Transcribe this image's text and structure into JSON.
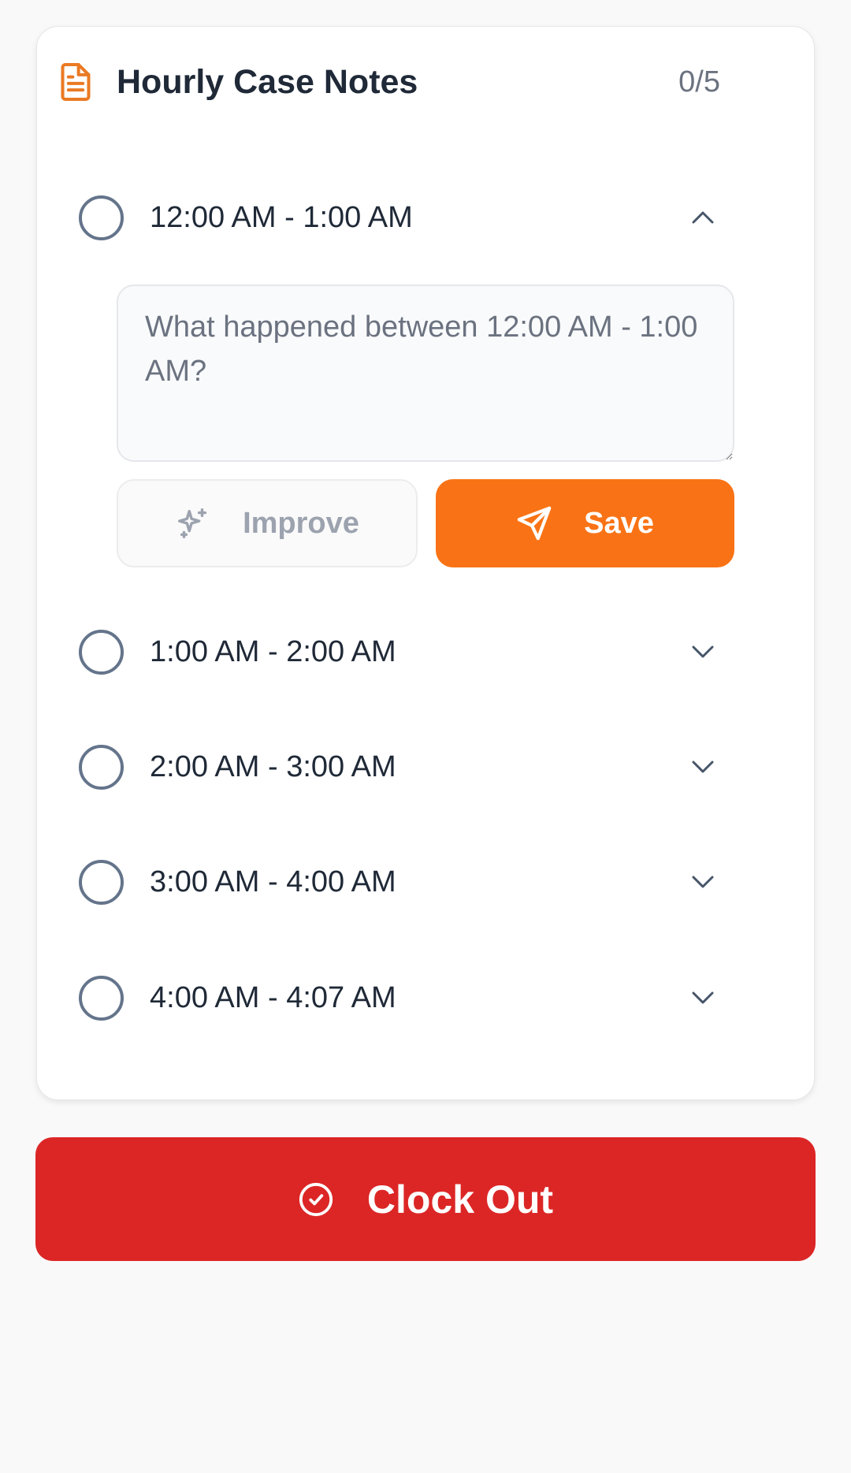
{
  "card": {
    "title": "Hourly Case Notes",
    "progress": "0/5",
    "title_icon": "document-icon"
  },
  "slots": [
    {
      "label": "12:00 AM - 1:00 AM",
      "expanded": true,
      "completed": false
    },
    {
      "label": "1:00 AM - 2:00 AM",
      "expanded": false,
      "completed": false
    },
    {
      "label": "2:00 AM - 3:00 AM",
      "expanded": false,
      "completed": false
    },
    {
      "label": "3:00 AM - 4:00 AM",
      "expanded": false,
      "completed": false
    },
    {
      "label": "4:00 AM - 4:07 AM",
      "expanded": false,
      "completed": false
    }
  ],
  "note": {
    "value": "",
    "placeholder": "What happened between 12:00 AM - 1:00 AM?"
  },
  "actions": {
    "improve_label": "Improve",
    "improve_icon": "sparkles-icon",
    "save_label": "Save",
    "save_icon": "send-icon"
  },
  "clock_out": {
    "label": "Clock Out",
    "icon": "check-circle-icon"
  },
  "colors": {
    "accent": "#f97316",
    "danger": "#dc2626",
    "icon_orange": "#ea7a24",
    "circle_gray": "#64748b"
  }
}
